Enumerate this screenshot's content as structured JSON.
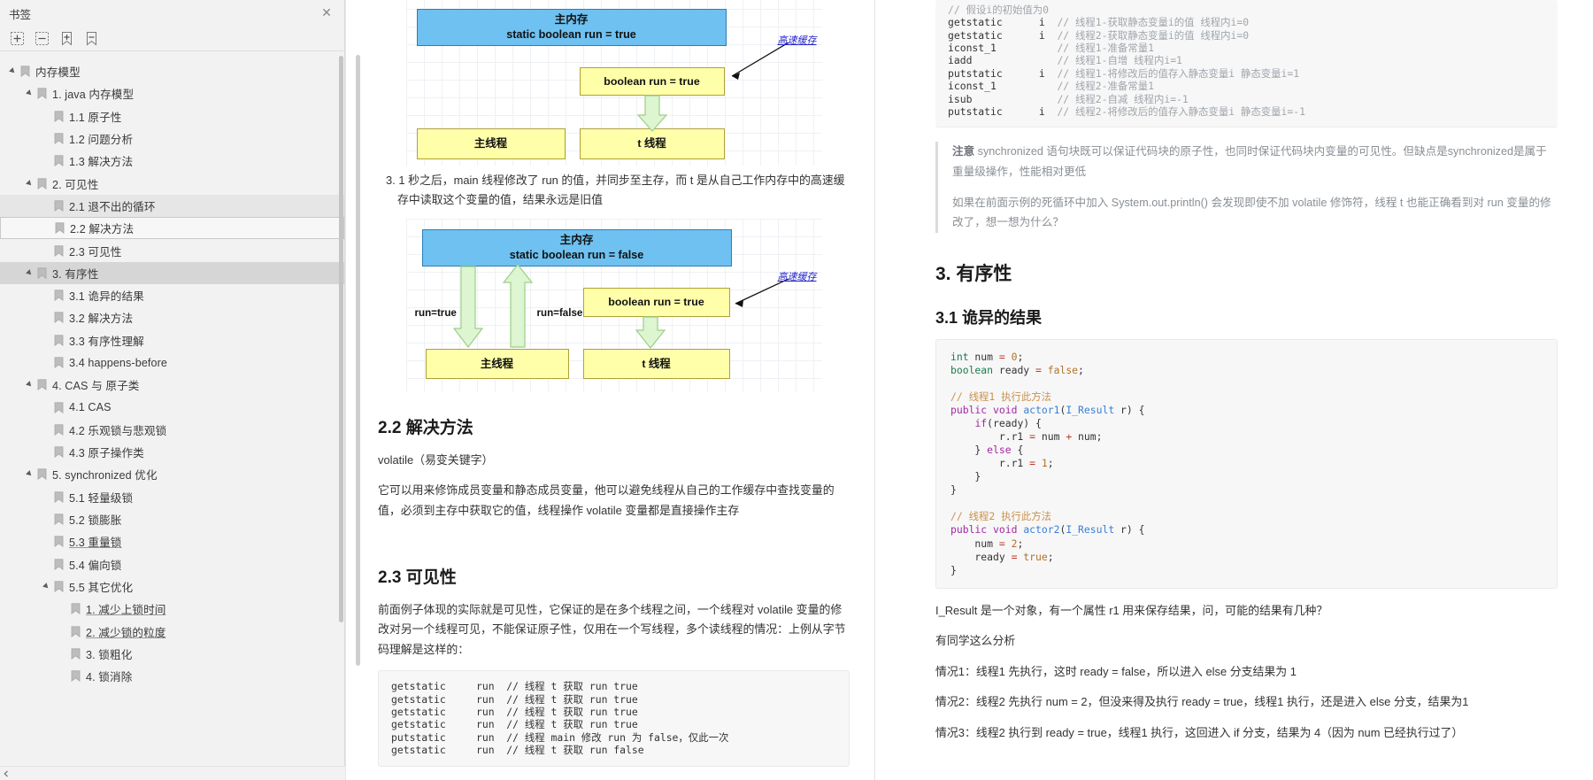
{
  "sidebar": {
    "title": "书签",
    "close_label": "✕",
    "toolbar": [
      {
        "name": "expand-all-icon",
        "label": "+"
      },
      {
        "name": "collapse-all-icon",
        "label": "−"
      },
      {
        "name": "add-bookmark-icon",
        "label": "+"
      },
      {
        "name": "remove-bookmark-icon",
        "label": "−"
      }
    ],
    "items": [
      {
        "label": "内存模型",
        "depth": 0,
        "caret": true,
        "selected": "none"
      },
      {
        "label": "1. java 内存模型",
        "depth": 1,
        "caret": true,
        "selected": "none"
      },
      {
        "label": "1.1 原子性",
        "depth": 2,
        "caret": false,
        "selected": "none"
      },
      {
        "label": "1.2 问题分析",
        "depth": 2,
        "caret": false,
        "selected": "none"
      },
      {
        "label": "1.3 解决方法",
        "depth": 2,
        "caret": false,
        "selected": "none"
      },
      {
        "label": "2. 可见性",
        "depth": 1,
        "caret": true,
        "selected": "none"
      },
      {
        "label": "2.1 退不出的循环",
        "depth": 2,
        "caret": false,
        "selected": "light"
      },
      {
        "label": "2.2 解决方法",
        "depth": 2,
        "caret": false,
        "selected": "box"
      },
      {
        "label": "2.3 可见性",
        "depth": 2,
        "caret": false,
        "selected": "none"
      },
      {
        "label": "3. 有序性",
        "depth": 1,
        "caret": true,
        "selected": "strong"
      },
      {
        "label": "3.1 诡异的结果",
        "depth": 2,
        "caret": false,
        "selected": "none"
      },
      {
        "label": "3.2 解决方法",
        "depth": 2,
        "caret": false,
        "selected": "none"
      },
      {
        "label": "3.3 有序性理解",
        "depth": 2,
        "caret": false,
        "selected": "none"
      },
      {
        "label": "3.4 happens-before",
        "depth": 2,
        "caret": false,
        "selected": "none"
      },
      {
        "label": "4. CAS 与 原子类",
        "depth": 1,
        "caret": true,
        "selected": "none"
      },
      {
        "label": "4.1 CAS",
        "depth": 2,
        "caret": false,
        "selected": "none"
      },
      {
        "label": "4.2 乐观锁与悲观锁",
        "depth": 2,
        "caret": false,
        "selected": "none"
      },
      {
        "label": "4.3 原子操作类",
        "depth": 2,
        "caret": false,
        "selected": "none"
      },
      {
        "label": "5. synchronized 优化",
        "depth": 1,
        "caret": true,
        "selected": "none"
      },
      {
        "label": "5.1 轻量级锁",
        "depth": 2,
        "caret": false,
        "selected": "none"
      },
      {
        "label": "5.2 锁膨胀",
        "depth": 2,
        "caret": false,
        "selected": "none"
      },
      {
        "label": "5.3 重量锁",
        "depth": 2,
        "caret": false,
        "selected": "none",
        "underline": true
      },
      {
        "label": "5.4 偏向锁",
        "depth": 2,
        "caret": false,
        "selected": "none"
      },
      {
        "label": "5.5 其它优化",
        "depth": 2,
        "caret": true,
        "selected": "none"
      },
      {
        "label": "1. 减少上锁时间",
        "depth": 3,
        "caret": false,
        "selected": "none",
        "underline": true
      },
      {
        "label": "2. 减少锁的粒度",
        "depth": 3,
        "caret": false,
        "selected": "none",
        "underline": true
      },
      {
        "label": "3. 锁粗化",
        "depth": 3,
        "caret": false,
        "selected": "none"
      },
      {
        "label": "4. 锁消除",
        "depth": 3,
        "caret": false,
        "selected": "none"
      }
    ]
  },
  "left_page": {
    "diagram1": {
      "main_memory_line1": "主内存",
      "main_memory_line2": "static boolean run = true",
      "cache_box": "boolean run = true",
      "main_thread": "主线程",
      "t_thread": "t 线程",
      "cache_label": "高速缓存"
    },
    "para_step3": "3. 1 秒之后，main 线程修改了 run 的值，并同步至主存，而 t 是从自己工作内存中的高速缓存中读取这个变量的值，结果永远是旧值",
    "diagram2": {
      "main_memory_line1": "主内存",
      "main_memory_line2": "static boolean run = false",
      "cache_box": "boolean run = true",
      "main_thread": "主线程",
      "t_thread": "t 线程",
      "cache_label": "高速缓存",
      "arrow_label_left": "run=true",
      "arrow_label_mid": "run=false"
    },
    "h_2_2": "2.2 解决方法",
    "p_volatile": "volatile（易变关键字）",
    "p_volatile_desc": "它可以用来修饰成员变量和静态成员变量，他可以避免线程从自己的工作缓存中查找变量的值，必须到主存中获取它的值，线程操作 volatile 变量都是直接操作主存",
    "h_2_3": "2.3 可见性",
    "p_visibility": "前面例子体现的实际就是可见性，它保证的是在多个线程之间，一个线程对 volatile 变量的修改对另一个线程可见，不能保证原子性，仅用在一个写线程，多个读线程的情况：上例从字节码理解是这样的：",
    "code_bytecode": "getstatic     run  // 线程 t 获取 run true\ngetstatic     run  // 线程 t 获取 run true\ngetstatic     run  // 线程 t 获取 run true\ngetstatic     run  // 线程 t 获取 run true\nputstatic     run  // 线程 main 修改 run 为 false，仅此一次\ngetstatic     run  // 线程 t 获取 run false"
  },
  "right_page": {
    "code_bytecode_top": [
      {
        "t": "// 假设i的初始值为0",
        "c": "cmt2"
      },
      {
        "t": "getstatic      i  // 线程1-获取静态变量i的值 线程内i=0"
      },
      {
        "t": "getstatic      i  // 线程2-获取静态变量i的值 线程内i=0"
      },
      {
        "t": "iconst_1          // 线程1-准备常量1"
      },
      {
        "t": "iadd              // 线程1-自增 线程内i=1"
      },
      {
        "t": "putstatic      i  // 线程1-将修改后的值存入静态变量i 静态变量i=1"
      },
      {
        "t": "iconst_1          // 线程2-准备常量1"
      },
      {
        "t": "isub              // 线程2-自减 线程内i=-1"
      },
      {
        "t": "putstatic      i  // 线程2-将修改后的值存入静态变量i 静态变量i=-1"
      }
    ],
    "note_p1_bold": "注意",
    "note_p1": " synchronized 语句块既可以保证代码块的原子性，也同时保证代码块内变量的可见性。但缺点是synchronized是属于重量级操作，性能相对更低",
    "note_p2": "如果在前面示例的死循环中加入 System.out.println() 会发现即使不加 volatile 修饰符，线程 t 也能正确看到对 run 变量的修改了，想一想为什么？",
    "h_3": "3. 有序性",
    "h_3_1": "3.1 诡异的结果",
    "code_java": "int num = 0;\nboolean ready = false;\n\n// 线程1 执行此方法\npublic void actor1(I_Result r) {\n    if(ready) {\n        r.r1 = num + num;\n    } else {\n        r.r1 = 1;\n    }\n}\n\n// 线程2 执行此方法\npublic void actor2(I_Result r) {\n    num = 2;\n    ready = true;\n}",
    "p1": "I_Result 是一个对象，有一个属性 r1 用来保存结果，问，可能的结果有几种？",
    "p2": "有同学这么分析",
    "p3": "情况1：线程1 先执行，这时 ready = false，所以进入 else 分支结果为 1",
    "p4": "情况2：线程2 先执行 num = 2，但没来得及执行 ready = true，线程1 执行，还是进入 else 分支，结果为1",
    "p5": "情况3：线程2 执行到 ready = true，线程1 执行，这回进入 if 分支，结果为 4（因为 num 已经执行过了）"
  },
  "colors": {
    "main_memory_fill": "#6ec1f0",
    "thread_fill": "#ffffaa",
    "arrow_fill": "#ddf5d0",
    "cache_label": "#2222cc",
    "selection": "#d6d6d6"
  }
}
